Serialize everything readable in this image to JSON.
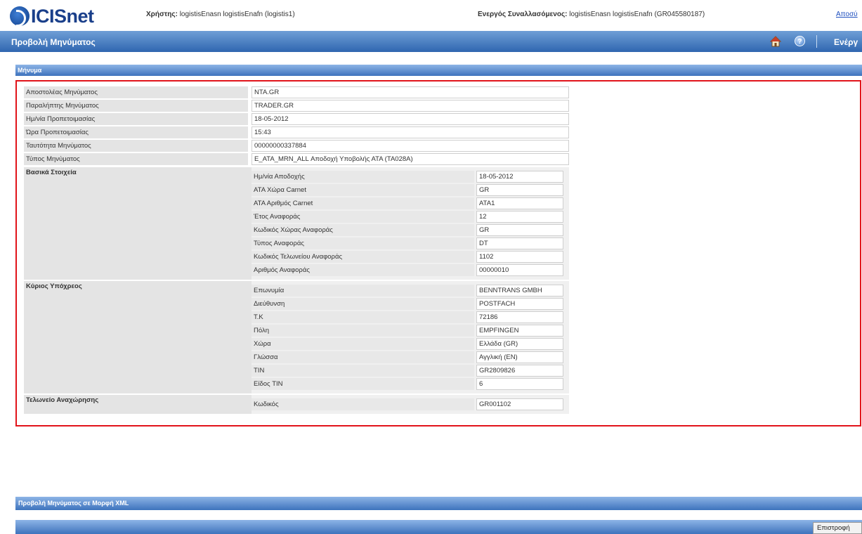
{
  "header": {
    "logo_text": "ICISnet",
    "user_label": "Χρήστης:",
    "user_value": "logistisEnasn logistisEnafn (logistis1)",
    "active_label": "Ενεργός Συναλλασόμενος:",
    "active_value": "logistisEnasn logistisEnafn (GR045580187)",
    "logout_link": "Αποσύ"
  },
  "titlebar": {
    "title": "Προβολή Μηνύματος",
    "enable_link": "Ενέργ"
  },
  "message_section": {
    "heading": "Μήνυμα",
    "fields": [
      {
        "label": "Αποστολέας Μηνύματος",
        "value": "NTA.GR"
      },
      {
        "label": "Παραλήπτης Μηνύματος",
        "value": "TRADER.GR"
      },
      {
        "label": "Ημ/νία Προπετοιμασίας",
        "value": "18-05-2012"
      },
      {
        "label": "Ώρα Προπετοιμασίας",
        "value": "15:43"
      },
      {
        "label": "Ταυτότητα Μηνύματος",
        "value": "00000000337884"
      },
      {
        "label": "Τύπος Μηνύματος",
        "value": "E_ATA_MRN_ALL Αποδοχή Υποβολής ΑΤΑ (TA028A)"
      }
    ],
    "groups": [
      {
        "title": "Βασικά Στοιχεία",
        "rows": [
          {
            "label": "Ημ/νία Αποδοχής",
            "value": "18-05-2012"
          },
          {
            "label": "ΑΤΑ Χώρα Carnet",
            "value": "GR"
          },
          {
            "label": "ΑΤΑ Αριθμός Carnet",
            "value": "ATA1"
          },
          {
            "label": "Έτος Αναφοράς",
            "value": "12"
          },
          {
            "label": "Κωδικός Χώρας Αναφοράς",
            "value": "GR"
          },
          {
            "label": "Τύπος Αναφοράς",
            "value": "DT"
          },
          {
            "label": "Κωδικός Τελωνείου Αναφοράς",
            "value": "1102"
          },
          {
            "label": "Αριθμός Αναφοράς",
            "value": "00000010"
          }
        ]
      },
      {
        "title": "Κύριος Υπόχρεος",
        "rows": [
          {
            "label": "Επωνυμία",
            "value": "BENNTRANS GMBH"
          },
          {
            "label": "Διεύθυνση",
            "value": "POSTFACH"
          },
          {
            "label": "Τ.Κ",
            "value": "72186"
          },
          {
            "label": "Πόλη",
            "value": "EMPFINGEN"
          },
          {
            "label": "Χώρα",
            "value": "Ελλάδα (GR)"
          },
          {
            "label": "Γλώσσα",
            "value": "Αγγλική (EN)"
          },
          {
            "label": "TIN",
            "value": "GR2809826"
          },
          {
            "label": "Είδος TIN",
            "value": "6"
          }
        ]
      },
      {
        "title": "Τελωνείο Αναχώρησης",
        "rows": [
          {
            "label": "Κωδικός",
            "value": "GR001102"
          }
        ]
      }
    ]
  },
  "xml_section": {
    "heading": "Προβολή Μηνύματος σε Μορφή XML"
  },
  "footer": {
    "return_button": "Επιστροφή"
  }
}
